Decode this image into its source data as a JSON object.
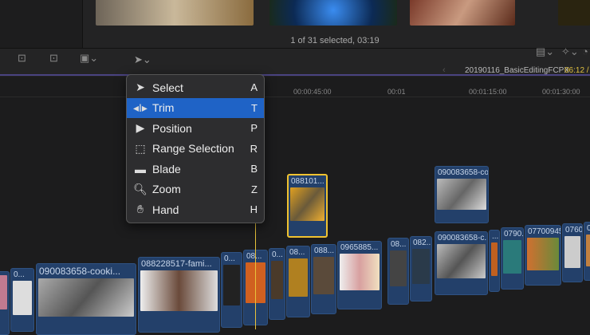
{
  "browser": {
    "status": "1 of 31 selected, 03:19"
  },
  "toolbar": {
    "project_name": "20190116_BasicEditingFCPX",
    "timecode": "06:12 /"
  },
  "ruler": [
    "00:00:45:00",
    "00:01",
    "00:01:15:00",
    "00:01:30:00"
  ],
  "tool_menu": {
    "items": [
      {
        "label": "Select",
        "key": "A",
        "icon": "arrow-icon"
      },
      {
        "label": "Trim",
        "key": "T",
        "icon": "trim-icon",
        "selected": true
      },
      {
        "label": "Position",
        "key": "P",
        "icon": "position-icon"
      },
      {
        "label": "Range Selection",
        "key": "R",
        "icon": "range-selection-icon"
      },
      {
        "label": "Blade",
        "key": "B",
        "icon": "blade-icon"
      },
      {
        "label": "Zoom",
        "key": "Z",
        "icon": "zoom-icon"
      },
      {
        "label": "Hand",
        "key": "H",
        "icon": "hand-icon"
      }
    ]
  },
  "connected_clips": [
    "088101...",
    "090083658-co..."
  ],
  "storyline_clips": [
    "",
    "0...",
    "090083658-cooki...",
    "088228517-fami...",
    "0...",
    "08...",
    "0...",
    "08...",
    "088...",
    "0965885...",
    "08...",
    "082...",
    "090083658-c...",
    "...",
    "0790...",
    "077009451...",
    "0760...",
    "0"
  ],
  "colors": {
    "accent": "#1f63c6",
    "playhead": "#e8c23a",
    "clip": "#23406a"
  }
}
